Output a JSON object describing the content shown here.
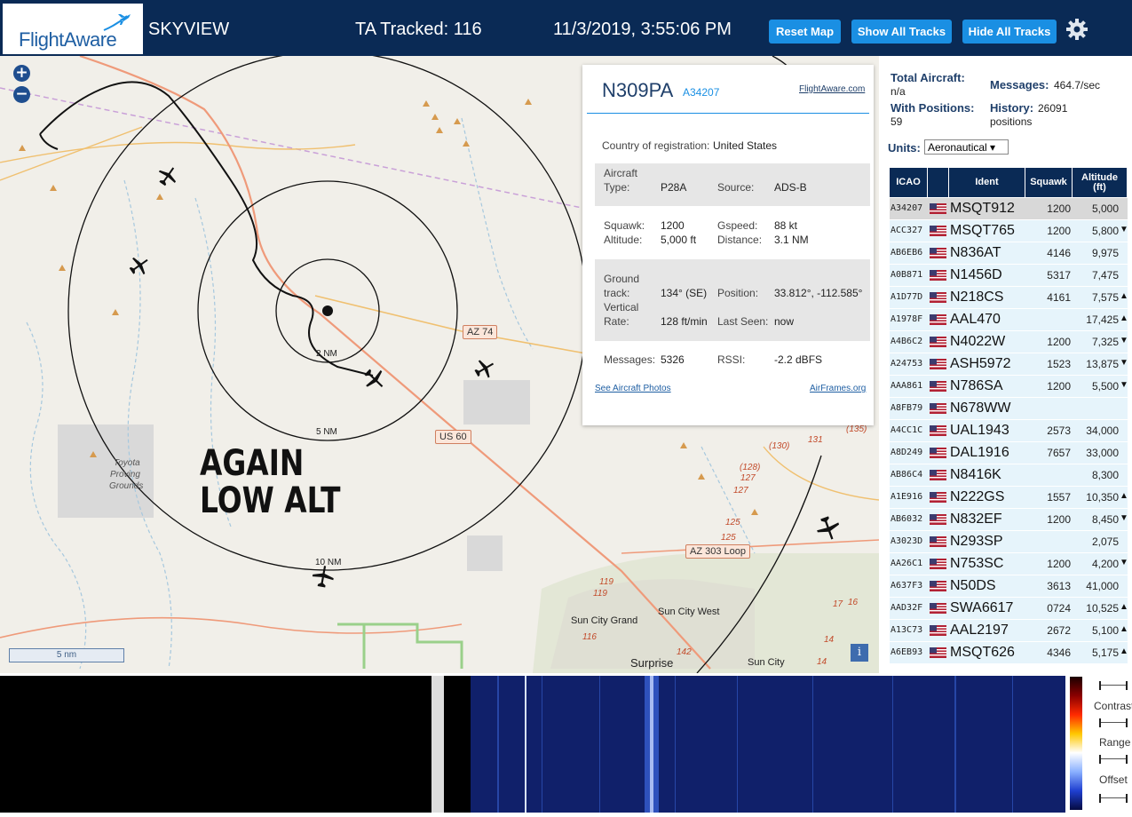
{
  "header": {
    "logo_text": "FlightAware",
    "app_name": "SKYVIEW",
    "tracked": "TA Tracked: 116",
    "datetime": "11/3/2019, 3:55:06 PM",
    "buttons": {
      "reset": "Reset Map",
      "show_all": "Show All Tracks",
      "hide_all": "Hide All Tracks"
    },
    "settings_icon": "gear-icon",
    "colors": {
      "header_bg": "#0a2a55",
      "button_bg": "#1a8fe3"
    }
  },
  "map": {
    "zoom_in": "+",
    "zoom_out": "−",
    "range_labels": [
      "2 NM",
      "5 NM",
      "10 NM"
    ],
    "annotation_line1": "AGAIN",
    "annotation_line2": "LOW ALT",
    "places": [
      "Toyota",
      "Proving",
      "Grounds",
      "Sun City Grand",
      "Sun City West",
      "Surprise",
      "Sun City"
    ],
    "shields": [
      "AZ 74",
      "US 60",
      "AZ 303 Loop"
    ],
    "route_numbers": [
      "(130)",
      "131",
      "(135)",
      "(128)",
      "127",
      "127",
      "125",
      "125",
      "119",
      "119",
      "116",
      "142",
      "17",
      "16",
      "14",
      "14"
    ],
    "scale": "5 nm",
    "info": "i"
  },
  "popup": {
    "ident": "N309PA",
    "hex": "A34207",
    "fa_link": "FlightAware.com",
    "country_label": "Country of registration:",
    "country": "United States",
    "aircraft_type_label1": "Aircraft",
    "aircraft_type_label2": "Type:",
    "aircraft_type": "P28A",
    "source_label": "Source:",
    "source": "ADS-B",
    "squawk_label": "Squawk:",
    "squawk": "1200",
    "gspeed_label": "Gspeed:",
    "gspeed": "88 kt",
    "altitude_label": "Altitude:",
    "altitude": "5,000 ft",
    "distance_label": "Distance:",
    "distance": "3.1 NM",
    "ground_label1": "Ground",
    "ground_label2": "track:",
    "ground_track": "134° (SE)",
    "position_label": "Position:",
    "position": "33.812°, -112.585°",
    "vertical_label1": "Vertical",
    "vertical_label2": "Rate:",
    "vertical_rate": "128 ft/min",
    "last_seen_label": "Last Seen:",
    "last_seen": "now",
    "messages_label": "Messages:",
    "messages": "5326",
    "rssi_label": "RSSI:",
    "rssi": "-2.2 dBFS",
    "photos_link": "See Aircraft Photos",
    "airframes_link": "AirFrames.org"
  },
  "sidebar": {
    "total_aircraft_label": "Total Aircraft:",
    "total_aircraft": "n/a",
    "messages_label": "Messages:",
    "messages": "464.7/sec",
    "with_positions_label": "With Positions:",
    "with_positions": "59",
    "history_label": "History:",
    "history": "26091",
    "history_unit": "positions",
    "units_label": "Units:",
    "units_value": "Aeronautical ▾",
    "columns": {
      "icao": "ICAO",
      "ident": "Ident",
      "squawk": "Squawk",
      "altitude1": "Altitude",
      "altitude2": "(ft)"
    },
    "rows": [
      {
        "icao": "A34207",
        "ident": "MSQT912",
        "squawk": "1200",
        "alt": "5,000",
        "trend": ""
      },
      {
        "icao": "ACC327",
        "ident": "MSQT765",
        "squawk": "1200",
        "alt": "5,800",
        "trend": "▼"
      },
      {
        "icao": "AB6EB6",
        "ident": "N836AT",
        "squawk": "4146",
        "alt": "9,975",
        "trend": ""
      },
      {
        "icao": "A0B871",
        "ident": "N1456D",
        "squawk": "5317",
        "alt": "7,475",
        "trend": ""
      },
      {
        "icao": "A1D77D",
        "ident": "N218CS",
        "squawk": "4161",
        "alt": "7,575",
        "trend": "▲"
      },
      {
        "icao": "A1978F",
        "ident": "AAL470",
        "squawk": "",
        "alt": "17,425",
        "trend": "▲"
      },
      {
        "icao": "A4B6C2",
        "ident": "N4022W",
        "squawk": "1200",
        "alt": "7,325",
        "trend": "▼"
      },
      {
        "icao": "A24753",
        "ident": "ASH5972",
        "squawk": "1523",
        "alt": "13,875",
        "trend": "▼"
      },
      {
        "icao": "AAA861",
        "ident": "N786SA",
        "squawk": "1200",
        "alt": "5,500",
        "trend": "▼"
      },
      {
        "icao": "A8FB79",
        "ident": "N678WW",
        "squawk": "",
        "alt": "",
        "trend": ""
      },
      {
        "icao": "A4CC1C",
        "ident": "UAL1943",
        "squawk": "2573",
        "alt": "34,000",
        "trend": ""
      },
      {
        "icao": "A8D249",
        "ident": "DAL1916",
        "squawk": "7657",
        "alt": "33,000",
        "trend": ""
      },
      {
        "icao": "AB86C4",
        "ident": "N8416K",
        "squawk": "",
        "alt": "8,300",
        "trend": ""
      },
      {
        "icao": "A1E916",
        "ident": "N222GS",
        "squawk": "1557",
        "alt": "10,350",
        "trend": "▲"
      },
      {
        "icao": "AB6032",
        "ident": "N832EF",
        "squawk": "1200",
        "alt": "8,450",
        "trend": "▼"
      },
      {
        "icao": "A3023D",
        "ident": "N293SP",
        "squawk": "",
        "alt": "2,075",
        "trend": ""
      },
      {
        "icao": "AA26C1",
        "ident": "N753SC",
        "squawk": "1200",
        "alt": "4,200",
        "trend": "▼"
      },
      {
        "icao": "A637F3",
        "ident": "N50DS",
        "squawk": "3613",
        "alt": "41,000",
        "trend": ""
      },
      {
        "icao": "AAD32F",
        "ident": "SWA6617",
        "squawk": "0724",
        "alt": "10,525",
        "trend": "▲"
      },
      {
        "icao": "A13C73",
        "ident": "AAL2197",
        "squawk": "2672",
        "alt": "5,100",
        "trend": "▲"
      },
      {
        "icao": "A6EB93",
        "ident": "MSQT626",
        "squawk": "4346",
        "alt": "5,175",
        "trend": "▲"
      }
    ]
  },
  "waterfall": {
    "contrast": "Contrast",
    "range": "Range",
    "offset": "Offset"
  }
}
